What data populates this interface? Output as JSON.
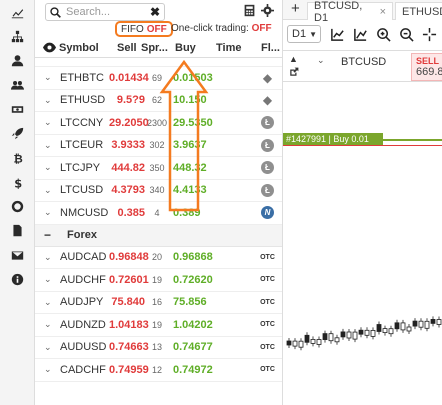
{
  "sidebar": {
    "items": [
      "chart-line-icon",
      "network-icon",
      "user-icon",
      "users-icon",
      "money-icon",
      "rocket-icon",
      "bitcoin-icon",
      "dollar-icon",
      "lifebuoy-icon",
      "document-icon",
      "envelope-icon",
      "info-icon"
    ]
  },
  "search": {
    "placeholder": "Search...",
    "clear": "✖"
  },
  "options": {
    "fifo_label": "FIFO",
    "fifo_state": "OFF",
    "oneclick_label": "One-click trading:",
    "oneclick_state": "OFF"
  },
  "table": {
    "headers": {
      "symbol": "Symbol",
      "sell": "Sell",
      "spread": "Spr...",
      "buy": "Buy",
      "time": "Time",
      "flag": "Fl..."
    },
    "crypto_rows": [
      {
        "symbol": "ETHBTC",
        "sell": "0.01434",
        "spread": "69",
        "buy": "0.01503",
        "flag": "eth"
      },
      {
        "symbol": "ETHUSD",
        "sell": "9.5?9",
        "spread": "62",
        "buy": "10.150",
        "flag": "eth"
      },
      {
        "symbol": "LTCCNY",
        "sell": "29.2050",
        "spread": "2300",
        "buy": "29.5350",
        "flag": "ltc"
      },
      {
        "symbol": "LTCEUR",
        "sell": "3.9333",
        "spread": "302",
        "buy": "3.9637",
        "flag": "ltc"
      },
      {
        "symbol": "LTCJPY",
        "sell": "444.82",
        "spread": "350",
        "buy": "448.32",
        "flag": "ltc"
      },
      {
        "symbol": "LTCUSD",
        "sell": "4.3793",
        "spread": "340",
        "buy": "4.4133",
        "flag": "ltc"
      },
      {
        "symbol": "NMCUSD",
        "sell": "0.385",
        "spread": "4",
        "buy": "0.389",
        "flag": "nmc"
      }
    ],
    "forex_label": "Forex",
    "forex_rows": [
      {
        "symbol": "AUDCAD",
        "sell": "0.96848",
        "spread": "20",
        "buy": "0.96868",
        "flag": "OTC"
      },
      {
        "symbol": "AUDCHF",
        "sell": "0.72601",
        "spread": "19",
        "buy": "0.72620",
        "flag": "OTC"
      },
      {
        "symbol": "AUDJPY",
        "sell": "75.840",
        "spread": "16",
        "buy": "75.856",
        "flag": "OTC"
      },
      {
        "symbol": "AUDNZD",
        "sell": "1.04183",
        "spread": "19",
        "buy": "1.04202",
        "flag": "OTC"
      },
      {
        "symbol": "AUDUSD",
        "sell": "0.74663",
        "spread": "13",
        "buy": "0.74677",
        "flag": "OTC"
      },
      {
        "symbol": "CADCHF",
        "sell": "0.74959",
        "spread": "12",
        "buy": "0.74972",
        "flag": "OTC"
      }
    ]
  },
  "chart": {
    "tabs": [
      "BTCUSD, D1",
      "ETHUSD"
    ],
    "tab_close": "×",
    "add_tab": "+",
    "timeframe": "D1",
    "symbol": "BTCUSD",
    "sell_label": "SELL",
    "sell_value": "669.8",
    "position_label": "#1427991 | Buy 0.01"
  },
  "colors": {
    "accent": "#f47b20",
    "sell": "#e03b3b",
    "buy": "#5fae27",
    "position": "#7ba62c"
  }
}
